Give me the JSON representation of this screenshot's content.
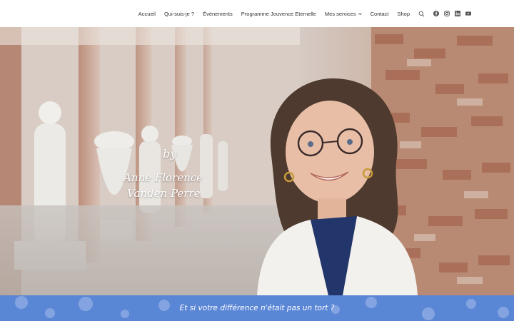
{
  "nav": {
    "items": [
      {
        "label": "Accueil"
      },
      {
        "label": "Qui-suis-je ?"
      },
      {
        "label": "Événements"
      },
      {
        "label": "Programme Jouvence Eternelle"
      },
      {
        "label": "Mes services"
      },
      {
        "label": "Contact"
      },
      {
        "label": "Shop"
      }
    ]
  },
  "icons": {
    "search": "search-icon",
    "social": [
      "facebook-icon",
      "instagram-icon",
      "linkedin-icon",
      "youtube-icon"
    ]
  },
  "hero": {
    "signature_by": "by",
    "signature_line1": "Anne Florence",
    "signature_line2": "Vanden Perre"
  },
  "banner": {
    "text": "Et si votre différence n'était pas un tort ?"
  },
  "colors": {
    "banner": "#5a86d6",
    "nav_text": "#333333"
  }
}
